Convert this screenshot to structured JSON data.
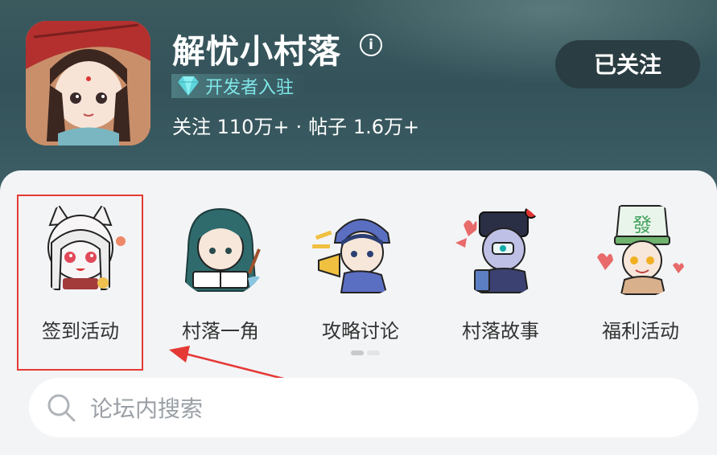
{
  "app": {
    "title": "解忧小村落",
    "info_icon": "info-icon",
    "developer_badge": "开发者入驻",
    "followers_label": "关注 110万+",
    "posts_label": "帖子 1.6万+",
    "separator": "·",
    "follow_button": "已关注"
  },
  "categories": [
    {
      "label": "签到活动",
      "icon": "white-fox-girl-avatar",
      "highlighted": true
    },
    {
      "label": "村落一角",
      "icon": "reading-girl-avatar"
    },
    {
      "label": "攻略讨论",
      "icon": "megaphone-boy-avatar"
    },
    {
      "label": "村落故事",
      "icon": "jiangshi-avatar"
    },
    {
      "label": "福利活动",
      "icon": "mahjong-hat-avatar"
    }
  ],
  "search": {
    "placeholder": "论坛内搜索",
    "icon": "search-icon"
  },
  "colors": {
    "header": "#3a5a5e",
    "accent": "#7fe6e8",
    "highlight": "#e53935",
    "button": "#2a3d42"
  }
}
